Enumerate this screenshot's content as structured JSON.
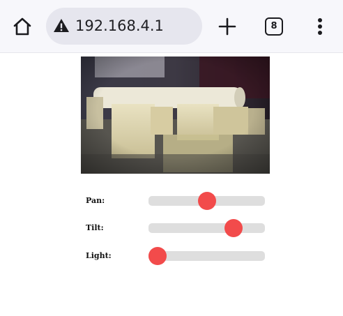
{
  "browser": {
    "url": "192.168.4.1",
    "tab_count": "8",
    "icons": [
      "home-icon",
      "warning-icon",
      "plus-icon",
      "tabs-icon",
      "more-vert-icon"
    ]
  },
  "camera": {
    "description": "live camera stream image"
  },
  "controls": [
    {
      "label": "Pan:",
      "value": 0.5
    },
    {
      "label": "Tilt:",
      "value": 0.73
    },
    {
      "label": "Light:",
      "value": 0.08
    }
  ],
  "colors": {
    "slider_thumb": "#f24b4b",
    "slider_track": "#dedede",
    "toolbar_bg": "#f7f7fb",
    "url_pill_bg": "#e6e6ee"
  }
}
